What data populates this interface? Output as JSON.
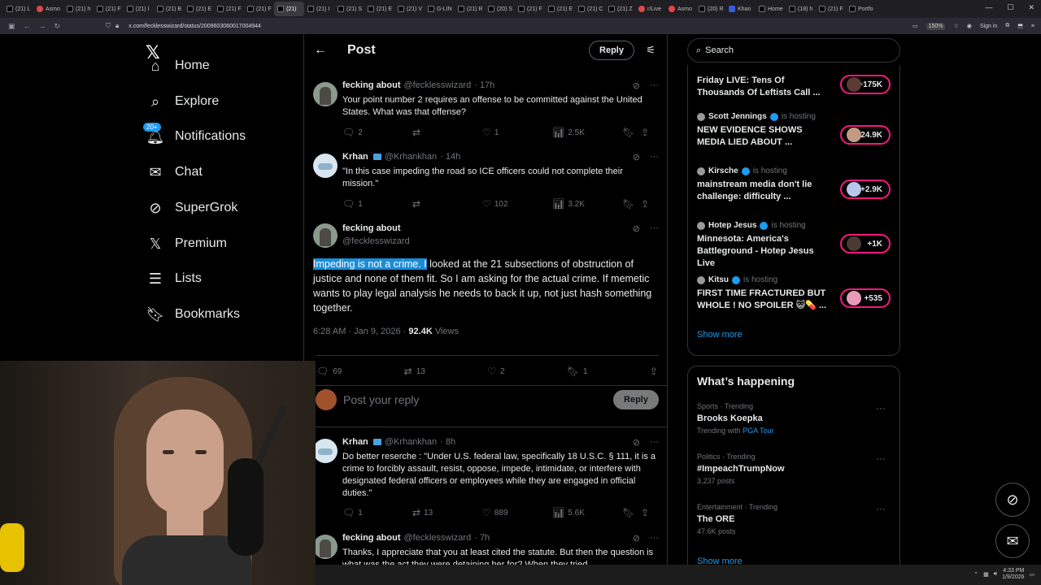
{
  "browser": {
    "tabs": [
      {
        "label": "(21) L",
        "icon": "x"
      },
      {
        "label": "Asmo",
        "icon": "o"
      },
      {
        "label": "(21) h",
        "icon": "x"
      },
      {
        "label": "(21) F",
        "icon": "x"
      },
      {
        "label": "(21) I",
        "icon": "x"
      },
      {
        "label": "(21) B",
        "icon": "x"
      },
      {
        "label": "(21) E",
        "icon": "x"
      },
      {
        "label": "(21) F",
        "icon": "x"
      },
      {
        "label": "(21) F",
        "icon": "x"
      },
      {
        "label": "(21)",
        "icon": "x",
        "active": true
      },
      {
        "label": "(21) I",
        "icon": "x"
      },
      {
        "label": "(21) S",
        "icon": "x"
      },
      {
        "label": "(21) E",
        "icon": "x"
      },
      {
        "label": "(21) V",
        "icon": "x"
      },
      {
        "label": "G-LIN",
        "icon": "x"
      },
      {
        "label": "(21) R",
        "icon": "x"
      },
      {
        "label": "(20) S",
        "icon": "x"
      },
      {
        "label": "(21) F",
        "icon": "x"
      },
      {
        "label": "(21) E",
        "icon": "x"
      },
      {
        "label": "(21) C",
        "icon": "x"
      },
      {
        "label": "(21) Z",
        "icon": "x"
      },
      {
        "label": "r/Live",
        "icon": "o"
      },
      {
        "label": "Asmo",
        "icon": "o"
      },
      {
        "label": "(20) R",
        "icon": "x"
      },
      {
        "label": "Khan",
        "icon": "b"
      },
      {
        "label": "Home",
        "icon": "x"
      },
      {
        "label": "(18) h",
        "icon": "x"
      },
      {
        "label": "(21) F",
        "icon": "x"
      },
      {
        "label": "Portfo",
        "icon": "x"
      }
    ],
    "url": "x.com/fecklesswizard/status/2009603060017004944",
    "zoom": "150%",
    "sign_in": "Sign in"
  },
  "nav": {
    "items": [
      {
        "label": "Home",
        "icon": "home-icon",
        "glyph": "⌂"
      },
      {
        "label": "Explore",
        "icon": "search-icon",
        "glyph": "⌕"
      },
      {
        "label": "Notifications",
        "icon": "bell-icon",
        "glyph": "🔔︎",
        "badge": "20+"
      },
      {
        "label": "Chat",
        "icon": "mail-icon",
        "glyph": "✉"
      },
      {
        "label": "SuperGrok",
        "icon": "grok-icon",
        "glyph": "⊘"
      },
      {
        "label": "Premium",
        "icon": "x-logo-icon",
        "glyph": "𝕏"
      },
      {
        "label": "Lists",
        "icon": "list-icon",
        "glyph": "☰"
      },
      {
        "label": "Bookmarks",
        "icon": "bookmark-icon",
        "glyph": "🔖︎"
      }
    ]
  },
  "header": {
    "title": "Post",
    "reply_label": "Reply"
  },
  "tweets": [
    {
      "name": "fecking about",
      "handle": "@fecklesswizard",
      "time": "· 17h",
      "text": "Your point number 2 requires an offense to be committed against the United States. What was that offense?",
      "replies": "2",
      "reposts": "",
      "likes": "1",
      "views": "2.5K"
    },
    {
      "name": "Krhan",
      "handle": "@Krhankhan",
      "time": "· 14h",
      "text": "\"In this case impeding the road so ICE officers could not complete their mission.\"",
      "replies": "1",
      "reposts": "",
      "likes": "102",
      "views": "3.2K"
    }
  ],
  "main_tweet": {
    "name": "fecking about",
    "handle": "@fecklesswizard",
    "highlighted": "Impeding is not a crime. I",
    "text": " looked at the 21 subsections of obstruction of justice and none of them fit. So I am asking for the actual crime. If memetic wants to play legal analysis he needs to back it up, not just hash something together.",
    "timestamp": "6:28 AM · Jan 9, 2026 · ",
    "views_count": "92.4K",
    "views_label": " Views",
    "replies": "69",
    "reposts": "13",
    "likes": "2",
    "bookmarks": "1"
  },
  "reply_box": {
    "placeholder": "Post your reply",
    "button": "Reply"
  },
  "replies": [
    {
      "name": "Krhan",
      "handle": "@Krhankhan",
      "time": "· 8h",
      "text": "Do better reserche : \"Under U.S. federal law, specifically 18 U.S.C. § 111, it is a crime to forcibly assault, resist, oppose, impede, intimidate, or interfere with designated federal officers or employees while they are engaged in official duties.\"",
      "replies": "1",
      "reposts": "13",
      "likes": "889",
      "views": "5.6K"
    },
    {
      "name": "fecking about",
      "handle": "@fecklesswizard",
      "time": "· 7h",
      "text": "Thanks, I appreciate that you at least cited the statute. But then the question is what was the act they were detaining her for? When they tried"
    }
  ],
  "search": {
    "placeholder": "Search"
  },
  "spaces": [
    {
      "host": "",
      "status": "",
      "title": "Friday LIVE: Tens Of Thousands Of Leftists Call ...",
      "count": "+175K"
    },
    {
      "host": "Scott Jennings",
      "status": "is hosting",
      "title": "NEW EVIDENCE SHOWS MEDIA LIED ABOUT ...",
      "count": "+24.9K"
    },
    {
      "host": "Kirsche",
      "status": "is hosting",
      "title": "mainstream media don't lie challenge: difficulty ...",
      "count": "+2.9K"
    },
    {
      "host": "Hotep Jesus",
      "status": "is hosting",
      "title": "Minnesota: America's Battleground - Hotep Jesus Live",
      "count": "+1K"
    },
    {
      "host": "Kitsu",
      "status": "is hosting",
      "title": "FIRST TIME FRACTURED BUT WHOLE ! NO SPOILER 😺💊 ...",
      "count": "+535"
    }
  ],
  "show_more": "Show more",
  "happening": {
    "title": "What’s happening",
    "trends": [
      {
        "meta": "Sports · Trending",
        "name": "Brooks Koepka",
        "sub_prefix": "Trending with ",
        "sub_link": "PGA Tour"
      },
      {
        "meta": "Politics · Trending",
        "name": "#ImpeachTrumpNow",
        "sub_prefix": "3,237 posts",
        "sub_link": ""
      },
      {
        "meta": "Entertainment · Trending",
        "name": "The ORE",
        "sub_prefix": "47.6K posts",
        "sub_link": ""
      }
    ],
    "show_more": "Show more"
  },
  "taskbar": {
    "time": "4:33 PM",
    "date": "1/9/2026"
  }
}
